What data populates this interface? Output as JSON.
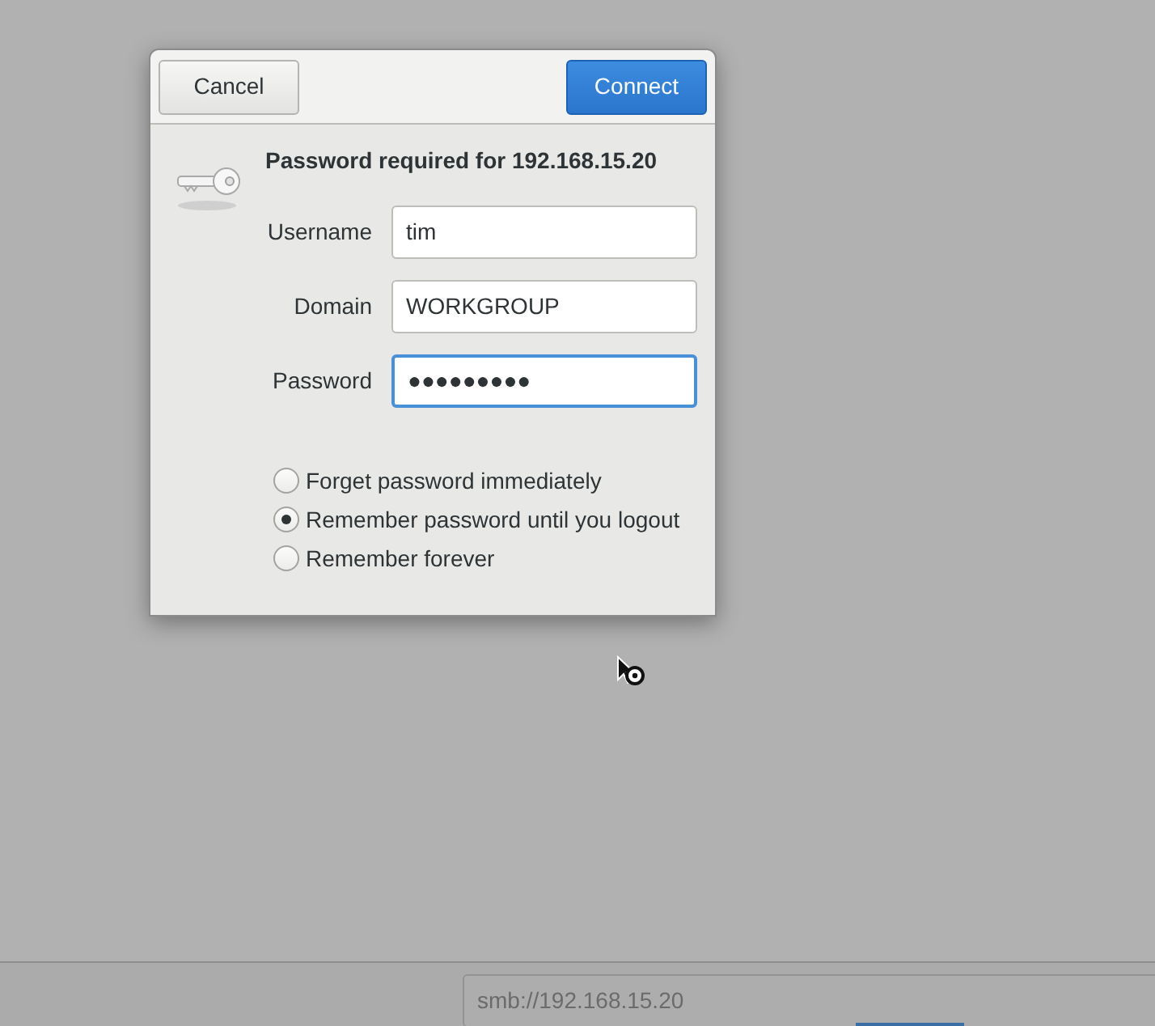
{
  "dialog": {
    "buttons": [
      {
        "label": "Cancel",
        "kind": "secondary"
      },
      {
        "label": "Connect",
        "kind": "primary"
      }
    ],
    "title": "Password required for 192.168.15.20",
    "fields": [
      {
        "label": "Username",
        "value": "tim",
        "focused": false
      },
      {
        "label": "Domain",
        "value": "WORKGROUP",
        "focused": false
      },
      {
        "label": "Password",
        "value": "●●●●●●●●●",
        "focused": true
      }
    ],
    "remember_options": [
      {
        "label": "Forget password immediately",
        "selected": false
      },
      {
        "label": "Remember password until you logout",
        "selected": true
      },
      {
        "label": "Remember forever",
        "selected": false
      }
    ]
  },
  "location_bar": {
    "value": "smb://192.168.15.20"
  }
}
